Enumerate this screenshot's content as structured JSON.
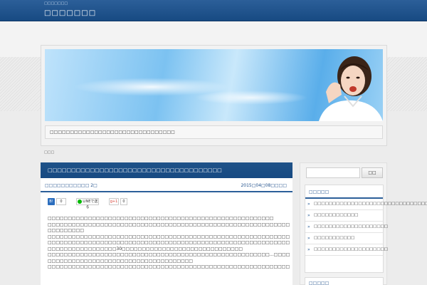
{
  "header": {
    "tagline": "□□□□□□□",
    "site_title": "□□□□□□□"
  },
  "hero": {
    "caption": "□□□□□□□□□□□□□□□□□□□□□□□□□□□□□□□"
  },
  "breadcrumb": "□□□",
  "post": {
    "title": "□□□□□□□□□□□□□□□□□□□□□□□□□□□□□□□□□□□□□",
    "category": "□□□□□□□□□□□ 2□",
    "date": "2015□04□08□□□□",
    "share": {
      "hatena_label": "B!",
      "hatena_count": "0",
      "line_label": "LINEで送る",
      "gplus_label": "g+1",
      "gplus_count": "0"
    },
    "paragraphs": [
      "□□□□□□□□□□□□□□□□□□□□□□□□□□□□□□□□□□□□□□□□□□□□□□□□□□□□□□□□",
      "□□□□□□□□□□□□□□□□□□□□□□□□□□□□□□□□□□□□□□□□□□□□□□□□□□□□□□□□□□□□□□□□□…□□□□□",
      "□□□□□□□□□",
      "□□□□□□□□□□□□□□□□□□□□□□□□□□□□□□□□□□□□□□□□□□□□□□□□□□□□□□□□□□□□□…□□□□□□□□□□",
      "□□□□□□□□□□□□□□□□□□□□□□□□□□□□□□□□□□□□□□□□□□□□□□□□□□□□□□□□□□□□□□□□□□□□□□□",
      "□□□□□□□□□□□□□□□□□30□□□□□□□□□□□□□□□□□□□□□□□□□□□□□□",
      "□□□□□□□□□□□□□□□□□□□□□□□□□□□□□□□□□□□□□□□□□□□□□□□□□□□□□□□…□□□□□□□□□□□□□□",
      "□□□□□□□□□□□□□□□□□□□□□□□□□□□□□□□□□□□□",
      "□□□□□□□□□□□□□□□□□□□□□□□□□□□□□□□□□□□□□□□□□□□□□□□□□□□□□□□□□□□□□□□□□□□□□□□□"
    ],
    "link_text": "□□□□□□□□□"
  },
  "sidebar": {
    "search_placeholder": "",
    "search_button": "□□",
    "widget_title": "□□□□□",
    "items": [
      "□□□□□□□□□□□□□□□□□□□□□□□□□□□□□□□□□□□□",
      "□□□□□□□□□□□□",
      "□□□□□□□□□□□□□□□□□□□□",
      "□□□□□□□□□□□",
      "□□□□□□□□□□□□□□□□□□□□"
    ],
    "widget2_title": "□□□□□"
  },
  "colors": {
    "header_blue": "#174a82",
    "accent_blue": "#2c5f99",
    "link_blue": "#1d62b8"
  }
}
